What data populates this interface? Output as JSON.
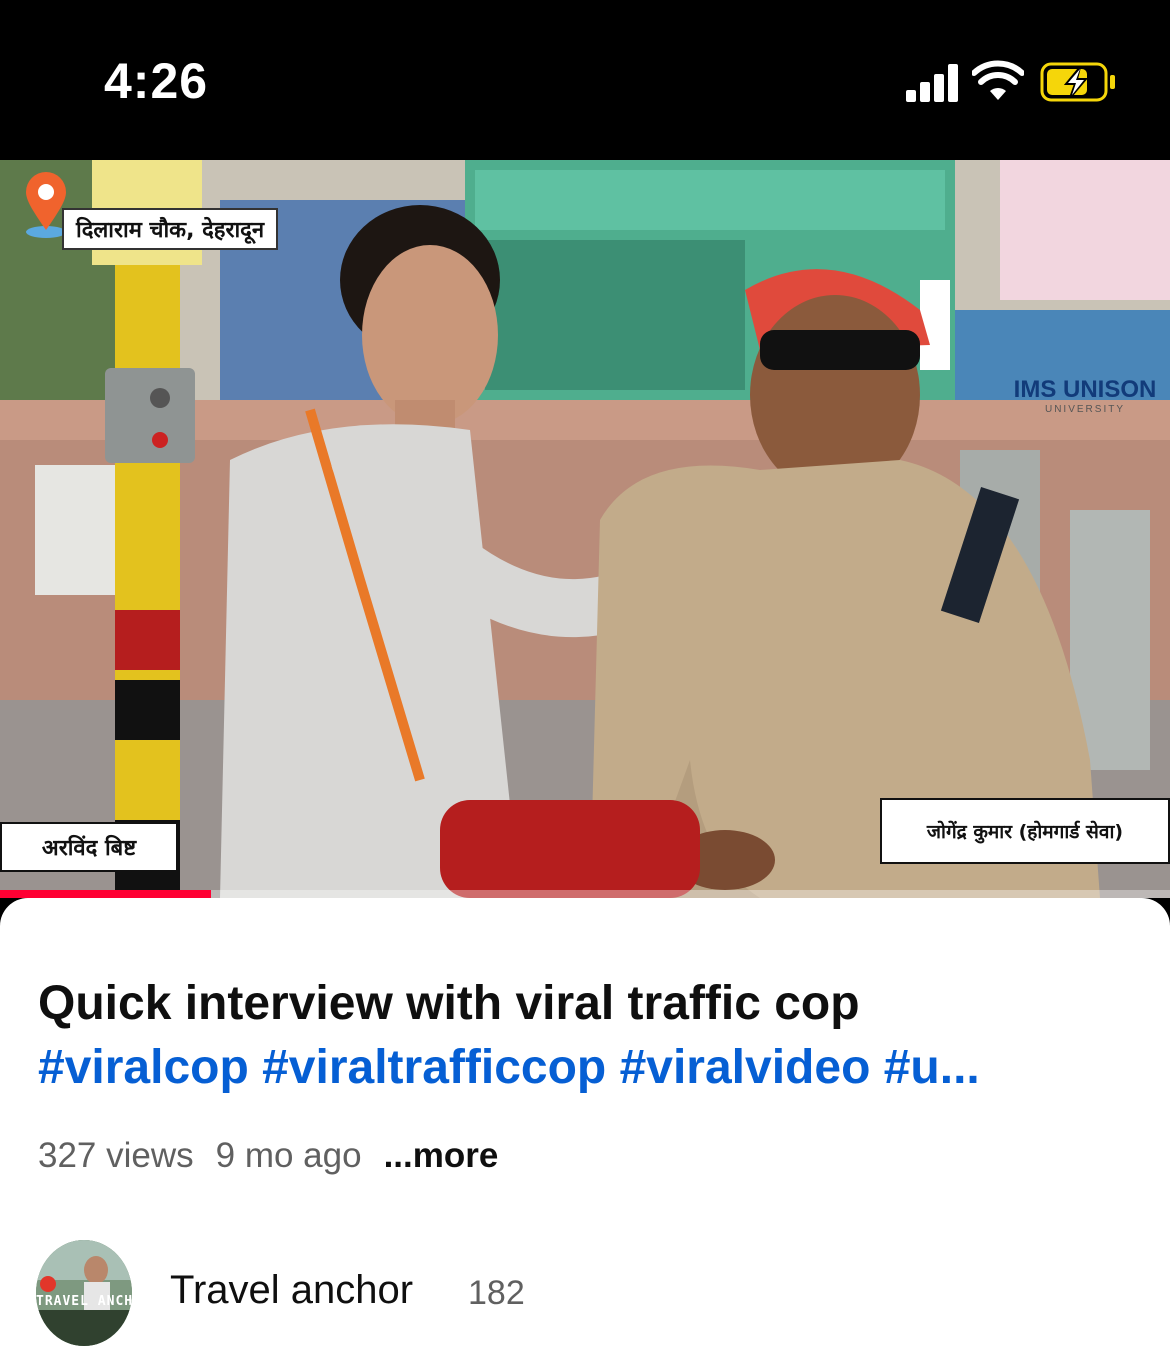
{
  "status_bar": {
    "time": "4:26"
  },
  "video": {
    "location_tag": "दिलाराम चौक, देहरादून",
    "reporter_name": "अरविंद बिष्ट",
    "guest_name": "जोगेंद्र कुमार (होमगार्ड सेवा)",
    "sponsor_logo": "IMS UNISON",
    "sponsor_sub": "UNIVERSITY",
    "progress": 0.18,
    "accent_color": "#ff0033"
  },
  "info": {
    "title": "Quick interview with viral traffic cop",
    "hashtags": "#viralcop #viraltrafficcop #viralvideo #u...",
    "views": "327 views",
    "age": "9 mo ago",
    "more": "...more",
    "hashtag_color": "#065fd4"
  },
  "channel": {
    "name": "Travel anchor",
    "subscribers": "182",
    "avatar_text": "TRAVEL ANCH"
  },
  "icons": [
    "signal-icon",
    "wifi-icon",
    "battery-charging-icon",
    "location-pin-icon"
  ]
}
